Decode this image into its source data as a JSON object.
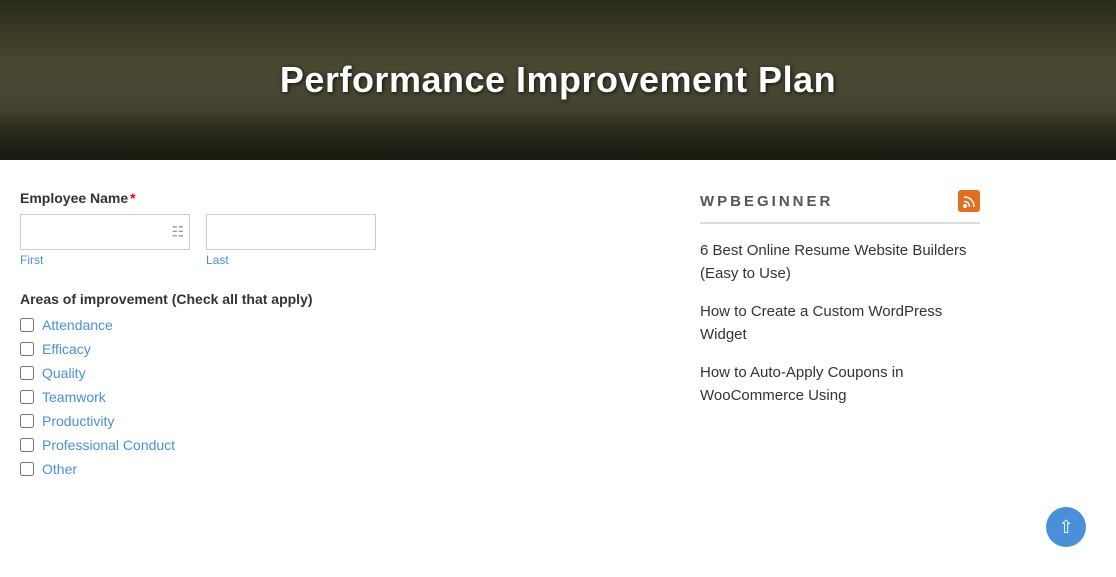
{
  "hero": {
    "title": "Performance Improvement Plan"
  },
  "form": {
    "employee_name_label": "Employee Name",
    "required_marker": "*",
    "first_label": "First",
    "last_label": "Last",
    "areas_label": "Areas of improvement (Check all that apply)",
    "checkboxes": [
      {
        "id": "attendance",
        "label": "Attendance"
      },
      {
        "id": "efficacy",
        "label": "Efficacy"
      },
      {
        "id": "quality",
        "label": "Quality"
      },
      {
        "id": "teamwork",
        "label": "Teamwork"
      },
      {
        "id": "productivity",
        "label": "Productivity"
      },
      {
        "id": "professional_conduct",
        "label": "Professional Conduct"
      },
      {
        "id": "other",
        "label": "Other"
      }
    ]
  },
  "sidebar": {
    "brand": "WPBEGINNER",
    "rss_label": "RSS",
    "links": [
      {
        "text": "6 Best Online Resume Website Builders (Easy to Use)"
      },
      {
        "text": "How to Create a Custom WordPress Widget"
      },
      {
        "text": "How to Auto-Apply Coupons in WooCommerce Using"
      }
    ]
  },
  "scroll_top": {
    "label": "Scroll to top"
  }
}
